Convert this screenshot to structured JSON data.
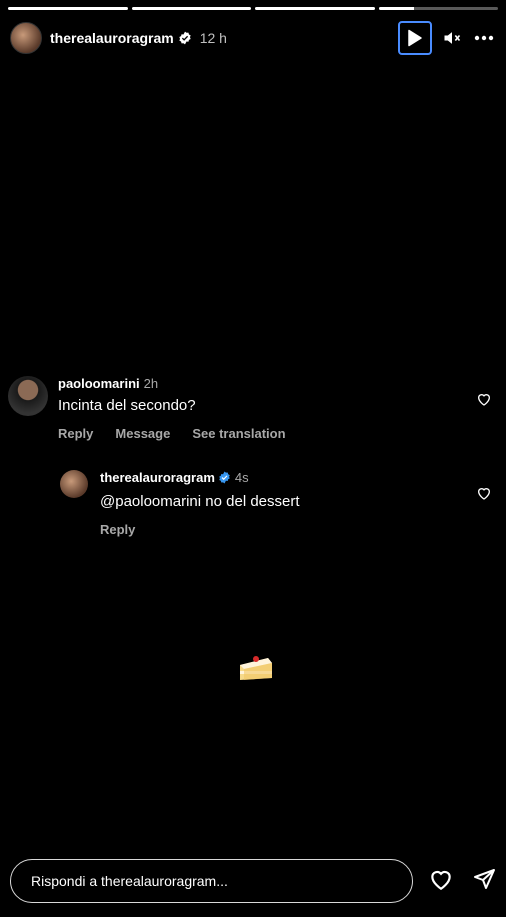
{
  "story": {
    "segments": [
      1,
      1,
      1,
      0.3
    ],
    "username": "therealauroragram",
    "time": "12 h"
  },
  "icons": {
    "verified": "verified-badge-icon",
    "play": "play-icon",
    "mute": "speaker-muted-icon",
    "more": "more-horizontal-icon",
    "like": "heart-icon",
    "send": "paper-plane-icon",
    "sticker": "cake-slice-icon"
  },
  "comments": [
    {
      "username": "paoloomarini",
      "time": "2h",
      "text": "Incinta del secondo?",
      "actions": [
        "Reply",
        "Message",
        "See translation"
      ]
    },
    {
      "username": "therealauroragram",
      "time": "4s",
      "text": "@paoloomarini no del dessert",
      "actions": [
        "Reply"
      ]
    }
  ],
  "footer": {
    "reply_placeholder": "Rispondi a therealauroragram..."
  },
  "colors": {
    "background": "#000000",
    "verified": "#3897f0",
    "play_focus": "#4a8cff",
    "muted_text": "#a8a8a8"
  }
}
